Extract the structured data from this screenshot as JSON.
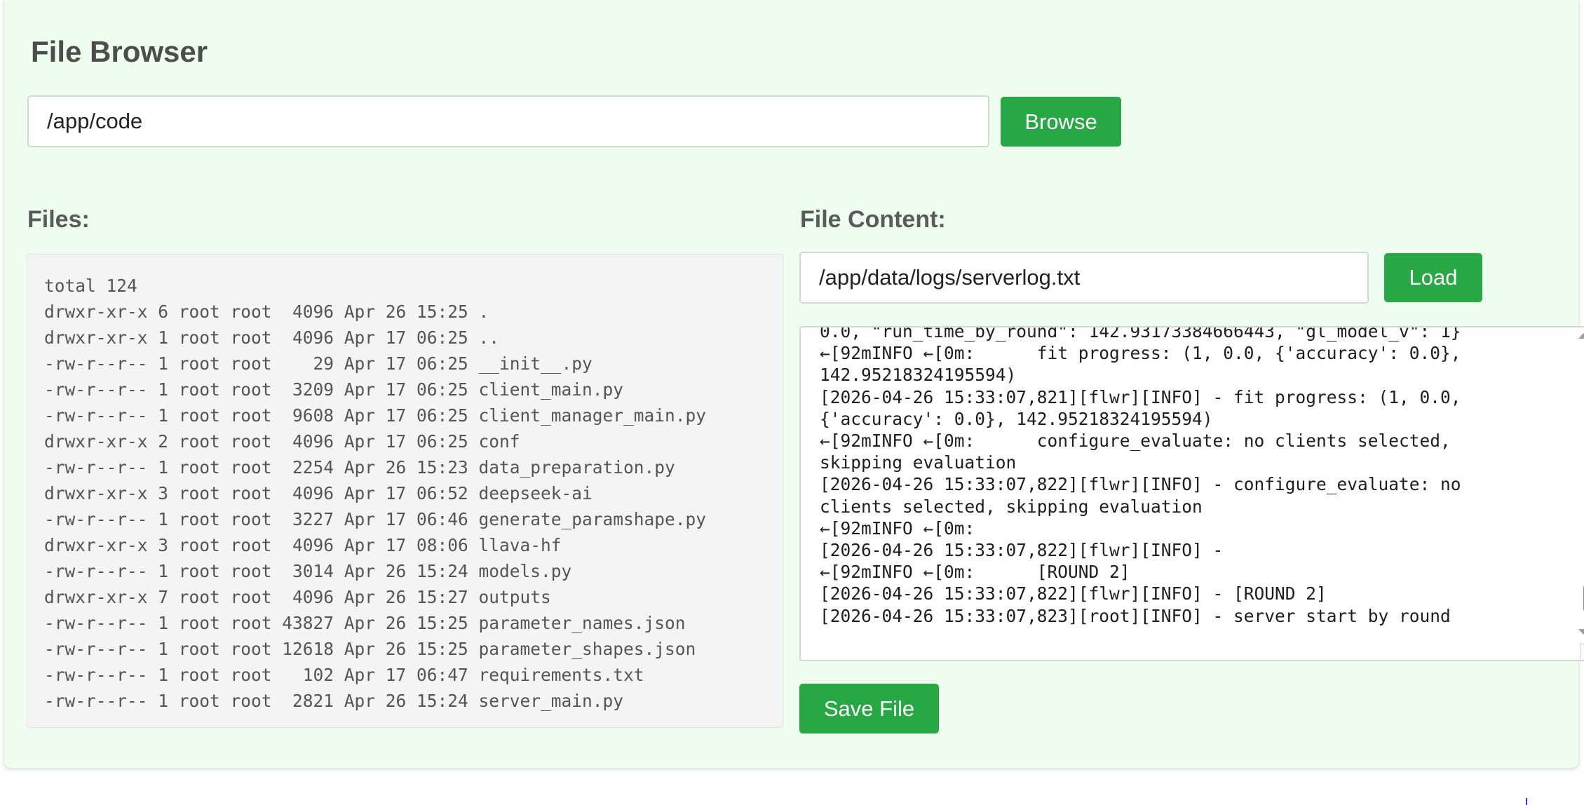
{
  "header": {
    "title": "File Browser"
  },
  "browse": {
    "path_value": "/app/code",
    "button_label": "Browse"
  },
  "files": {
    "label": "Files:",
    "listing": [
      "total 124",
      "drwxr-xr-x 6 root root  4096 Apr 26 15:25 .",
      "drwxr-xr-x 1 root root  4096 Apr 17 06:25 ..",
      "-rw-r--r-- 1 root root    29 Apr 17 06:25 __init__.py",
      "-rw-r--r-- 1 root root  3209 Apr 17 06:25 client_main.py",
      "-rw-r--r-- 1 root root  9608 Apr 17 06:25 client_manager_main.py",
      "drwxr-xr-x 2 root root  4096 Apr 17 06:25 conf",
      "-rw-r--r-- 1 root root  2254 Apr 26 15:23 data_preparation.py",
      "drwxr-xr-x 3 root root  4096 Apr 17 06:52 deepseek-ai",
      "-rw-r--r-- 1 root root  3227 Apr 17 06:46 generate_paramshape.py",
      "drwxr-xr-x 3 root root  4096 Apr 17 08:06 llava-hf",
      "-rw-r--r-- 1 root root  3014 Apr 26 15:24 models.py",
      "drwxr-xr-x 7 root root  4096 Apr 26 15:27 outputs",
      "-rw-r--r-- 1 root root 43827 Apr 26 15:25 parameter_names.json",
      "-rw-r--r-- 1 root root 12618 Apr 26 15:25 parameter_shapes.json",
      "-rw-r--r-- 1 root root   102 Apr 17 06:47 requirements.txt",
      "-rw-r--r-- 1 root root  2821 Apr 26 15:24 server_main.py"
    ]
  },
  "file_content": {
    "label": "File Content:",
    "path_value": "/app/data/logs/serverlog.txt",
    "load_label": "Load",
    "save_label": "Save File",
    "lines": [
      "0.0, \"run_time_by_round\": 142.93173384666443, \"gl_model_v\": 1}",
      "←[92mINFO ←[0m:      fit progress: (1, 0.0, {'accuracy': 0.0}, 142.95218324195594)",
      "[2026-04-26 15:33:07,821][flwr][INFO] - fit progress: (1, 0.0, {'accuracy': 0.0}, 142.95218324195594)",
      "←[92mINFO ←[0m:      configure_evaluate: no clients selected, skipping evaluation",
      "[2026-04-26 15:33:07,822][flwr][INFO] - configure_evaluate: no clients selected, skipping evaluation",
      "←[92mINFO ←[0m:",
      "[2026-04-26 15:33:07,822][flwr][INFO] -",
      "←[92mINFO ←[0m:      [ROUND 2]",
      "[2026-04-26 15:33:07,822][flwr][INFO] - [ROUND 2]",
      "[2026-04-26 15:33:07,823][root][INFO] - server start by round"
    ]
  }
}
